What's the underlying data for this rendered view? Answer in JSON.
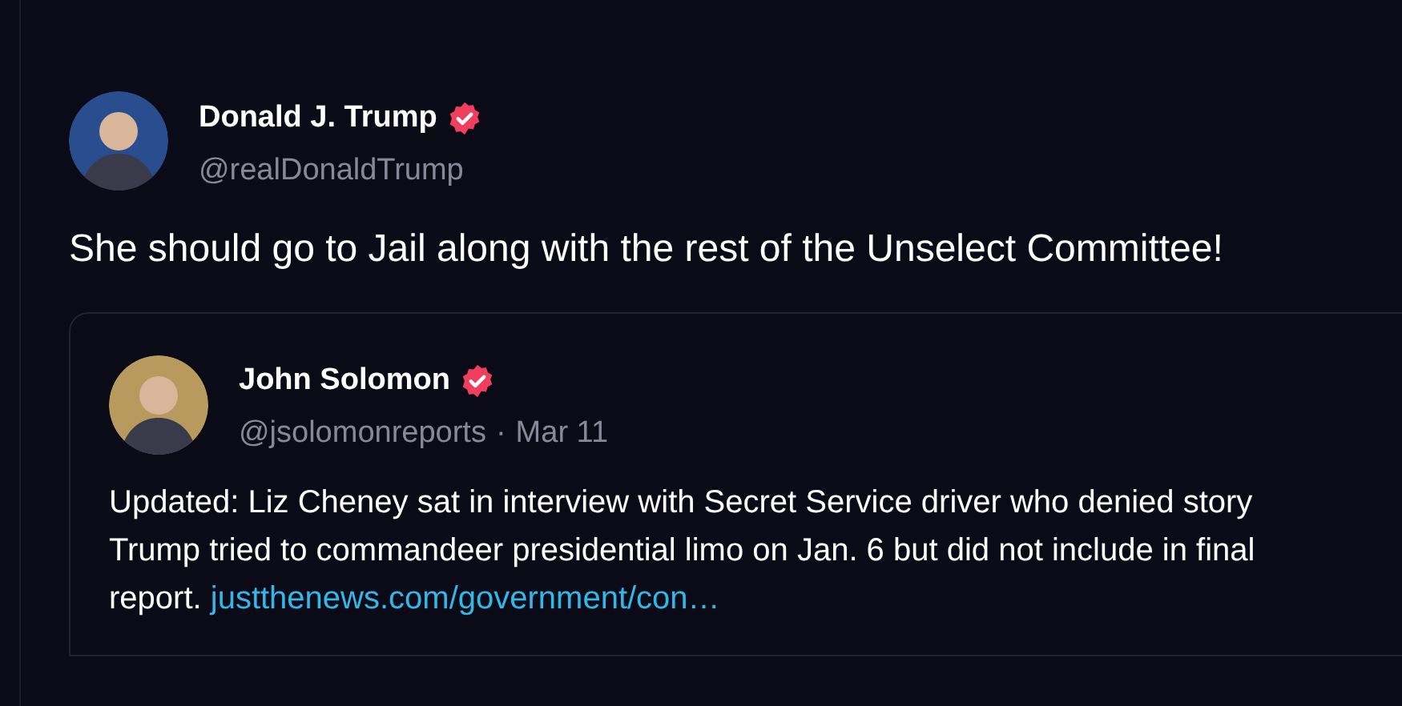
{
  "post": {
    "author": {
      "name": "Donald J. Trump",
      "handle": "@realDonaldTrump",
      "verified": true
    },
    "text": "She should go to Jail along with the rest of the Unselect Committee!",
    "quote": {
      "author": {
        "name": "John Solomon",
        "handle": "@jsolomonreports",
        "verified": true
      },
      "separator": "·",
      "date": "Mar 11",
      "text": "Updated: Liz Cheney sat in interview with Secret Service driver who denied story Trump tried to commandeer presidential limo on Jan. 6 but did not include in final report.",
      "link": "justthenews.com/government/con…"
    }
  }
}
